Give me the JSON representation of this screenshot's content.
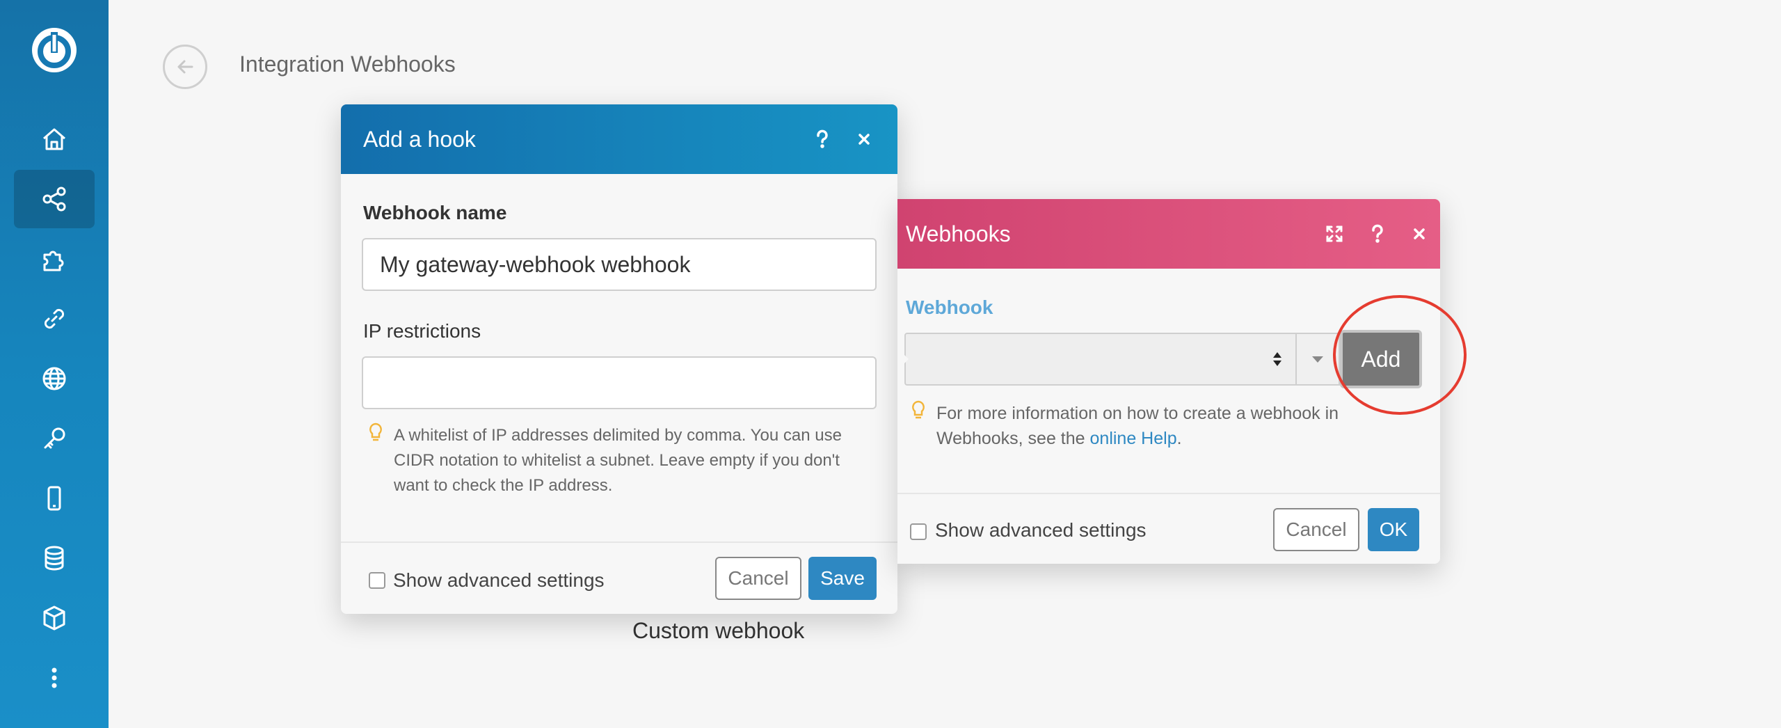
{
  "header": {
    "title": "Integration Webhooks"
  },
  "sidebar": {
    "items": [
      {
        "icon": "home-icon"
      },
      {
        "icon": "share-icon",
        "active": true
      },
      {
        "icon": "puzzle-icon"
      },
      {
        "icon": "link-icon"
      },
      {
        "icon": "globe-icon"
      },
      {
        "icon": "key-icon"
      },
      {
        "icon": "mobile-icon"
      },
      {
        "icon": "database-icon"
      },
      {
        "icon": "cube-icon"
      },
      {
        "icon": "more-vertical-icon"
      }
    ]
  },
  "canvas": {
    "module_label": "Custom webhook"
  },
  "hook_dialog": {
    "title": "Add a hook",
    "name_label": "Webhook name",
    "name_value": "My gateway-webhook webhook",
    "ip_label": "IP restrictions",
    "ip_value": "",
    "hint_line1": "A whitelist of IP addresses delimited by comma. You can use",
    "hint_line2": "CIDR notation to whitelist a subnet. Leave empty if you don't",
    "hint_line3": "want to check the IP address.",
    "advanced_label": "Show advanced settings",
    "cancel_label": "Cancel",
    "save_label": "Save"
  },
  "webhooks_dialog": {
    "title": "Webhooks",
    "field_label": "Webhook",
    "selected_value": "",
    "add_label": "Add",
    "hint_line1": "For more information on how to create a webhook in",
    "hint_line2_prefix": "Webhooks, see the ",
    "hint_link": "online Help",
    "hint_line2_suffix": ".",
    "advanced_label": "Show advanced settings",
    "cancel_label": "Cancel",
    "ok_label": "OK"
  },
  "colors": {
    "sidebar": "#1685bd",
    "hook_header": "#1894c5",
    "webhooks_header": "#d04370",
    "primary_button": "#2e88c2",
    "highlight_ellipse": "#e53c30"
  }
}
